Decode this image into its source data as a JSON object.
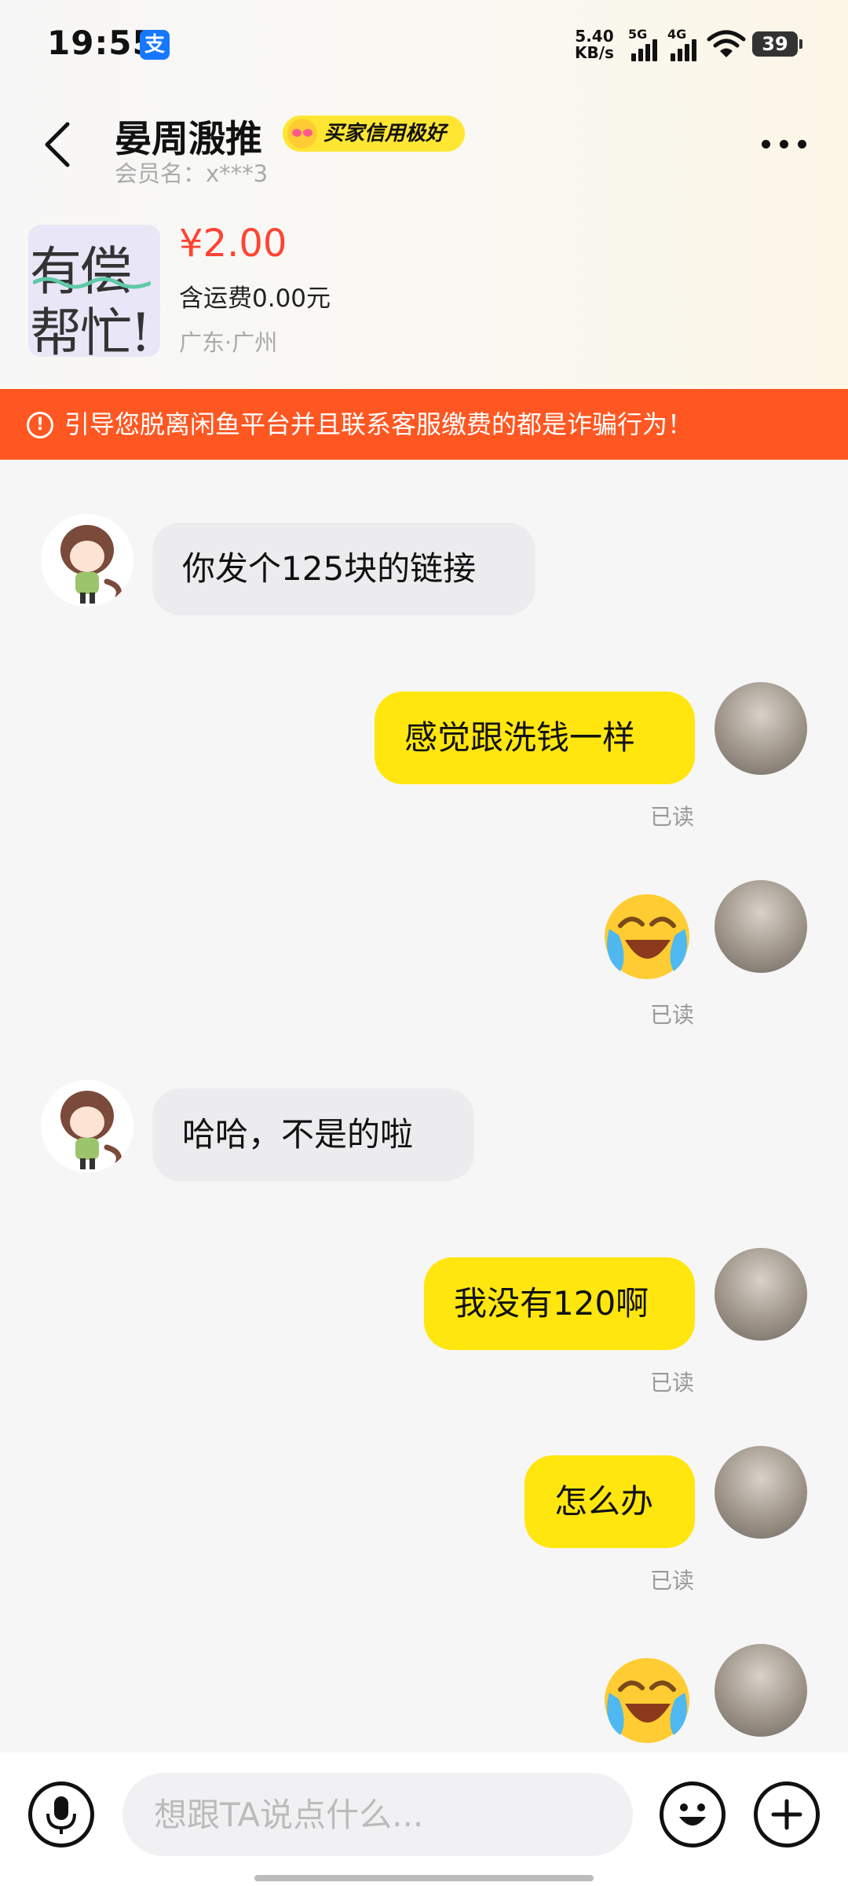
{
  "status_bar": {
    "time": "19:55",
    "alipay_icon": "支",
    "net_speed": "5.40",
    "net_unit": "KB/s",
    "sig1_label": "5G",
    "sig2_label": "4G",
    "battery": "39"
  },
  "header": {
    "name": "晏周溵推",
    "badge": "买家信用极好",
    "member": "会员名：x***3"
  },
  "product": {
    "thumb_line1": "有偿",
    "thumb_line2": "帮忙!",
    "price": "¥2.00",
    "shipping": "含运费0.00元",
    "location": "广东·广州"
  },
  "warning": {
    "text": "引导您脱离闲鱼平台并且联系客服缴费的都是诈骗行为！"
  },
  "messages": [
    {
      "from": "seller",
      "type": "text",
      "text": "你发个125块的链接"
    },
    {
      "from": "me",
      "type": "text",
      "text": "感觉跟洗钱一样",
      "status": "已读"
    },
    {
      "from": "me",
      "type": "emoji",
      "emoji": "crying-laughing-emoji",
      "status": "已读"
    },
    {
      "from": "seller",
      "type": "text",
      "text": "哈哈，不是的啦"
    },
    {
      "from": "me",
      "type": "text",
      "text": "我没有120啊",
      "status": "已读"
    },
    {
      "from": "me",
      "type": "text",
      "text": "怎么办",
      "status": "已读"
    },
    {
      "from": "me",
      "type": "emoji",
      "emoji": "crying-laughing-emoji"
    }
  ],
  "input": {
    "placeholder": "想跟TA说点什么..."
  },
  "colors": {
    "accent_yellow": "#ffe60f",
    "warning_orange": "#ff5722",
    "price_red": "#ff4433"
  }
}
